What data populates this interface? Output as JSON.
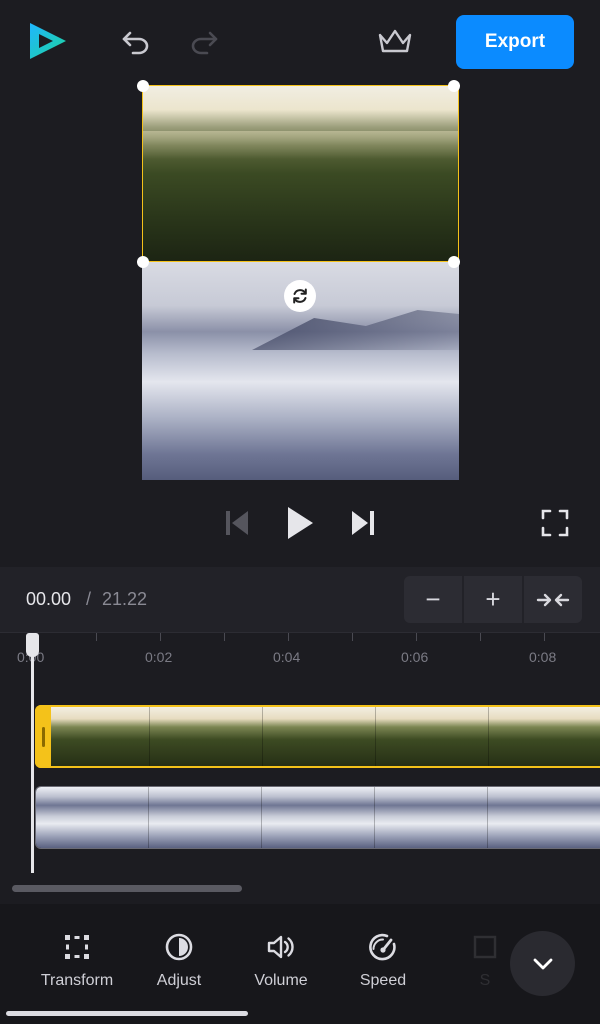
{
  "header": {
    "logo_icon": "logo-play-icon",
    "undo_icon": "undo-icon",
    "redo_icon": "redo-icon",
    "premium_icon": "crown-icon",
    "export_label": "Export",
    "accent_color": "#0b8bff"
  },
  "preview": {
    "rotate_icon": "rotate-icon",
    "selection_color": "#f4c21a"
  },
  "playback": {
    "prev_icon": "skip-back-icon",
    "play_icon": "play-icon",
    "next_icon": "skip-forward-icon",
    "fullscreen_icon": "fullscreen-icon"
  },
  "time": {
    "current": "00.00",
    "separator": "/",
    "total": "21.22"
  },
  "zoom": {
    "zoom_out": "−",
    "zoom_in": "+",
    "fit_icon": "fit-arrows-icon"
  },
  "ruler": {
    "ticks": [
      "0:00",
      "0:02",
      "0:04",
      "0:06",
      "0:08"
    ]
  },
  "toolbar": {
    "tools": [
      {
        "label": "Transform",
        "icon": "transform-icon"
      },
      {
        "label": "Adjust",
        "icon": "adjust-icon"
      },
      {
        "label": "Volume",
        "icon": "volume-icon"
      },
      {
        "label": "Speed",
        "icon": "speed-icon"
      },
      {
        "label": "S",
        "icon": "crop-icon"
      }
    ],
    "collapse_icon": "chevron-down-icon"
  }
}
